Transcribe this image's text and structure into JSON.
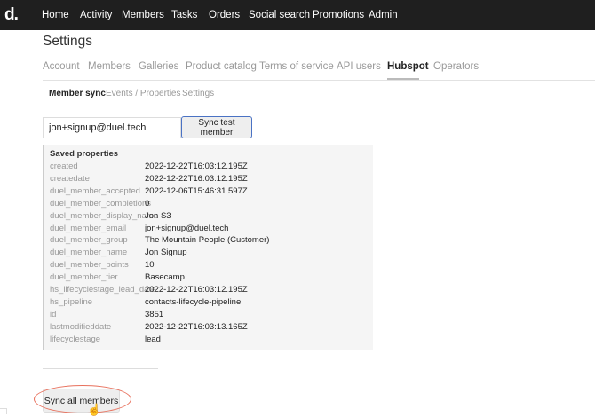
{
  "nav": {
    "logo": "d.",
    "items": [
      "Home",
      "Activity",
      "Members",
      "Tasks",
      "Orders",
      "Social search",
      "Promotions",
      "Admin"
    ]
  },
  "page_title": "Settings",
  "tabs": [
    "Account",
    "Members",
    "Galleries",
    "Product catalog",
    "Terms of service",
    "API users",
    "Hubspot",
    "Operators"
  ],
  "active_tab": "Hubspot",
  "subtabs": [
    "Member sync",
    "Events / Properties",
    "Settings"
  ],
  "active_subtab": "Member sync",
  "email_input": {
    "value": "jon+signup@duel.tech"
  },
  "sync_test_label": "Sync test member",
  "saved": {
    "title": "Saved properties",
    "rows": [
      {
        "k": "created",
        "v": "2022-12-22T16:03:12.195Z"
      },
      {
        "k": "createdate",
        "v": "2022-12-22T16:03:12.195Z"
      },
      {
        "k": "duel_member_accepted",
        "v": "2022-12-06T15:46:31.597Z"
      },
      {
        "k": "duel_member_completions",
        "v": "0"
      },
      {
        "k": "duel_member_display_name",
        "v": "Jon S3"
      },
      {
        "k": "duel_member_email",
        "v": "jon+signup@duel.tech"
      },
      {
        "k": "duel_member_group",
        "v": "The Mountain People (Customer)"
      },
      {
        "k": "duel_member_name",
        "v": "Jon Signup"
      },
      {
        "k": "duel_member_points",
        "v": "10"
      },
      {
        "k": "duel_member_tier",
        "v": "Basecamp"
      },
      {
        "k": "hs_lifecyclestage_lead_date",
        "v": "2022-12-22T16:03:12.195Z"
      },
      {
        "k": "hs_pipeline",
        "v": "contacts-lifecycle-pipeline"
      },
      {
        "k": "id",
        "v": "3851"
      },
      {
        "k": "lastmodifieddate",
        "v": "2022-12-22T16:03:13.165Z"
      },
      {
        "k": "lifecyclestage",
        "v": "lead"
      }
    ]
  },
  "sync_all_label": "Sync all members",
  "colors": {
    "nav_bg": "#1f1f1f",
    "highlight": "#e8705c",
    "button_border": "#4a72c4"
  }
}
